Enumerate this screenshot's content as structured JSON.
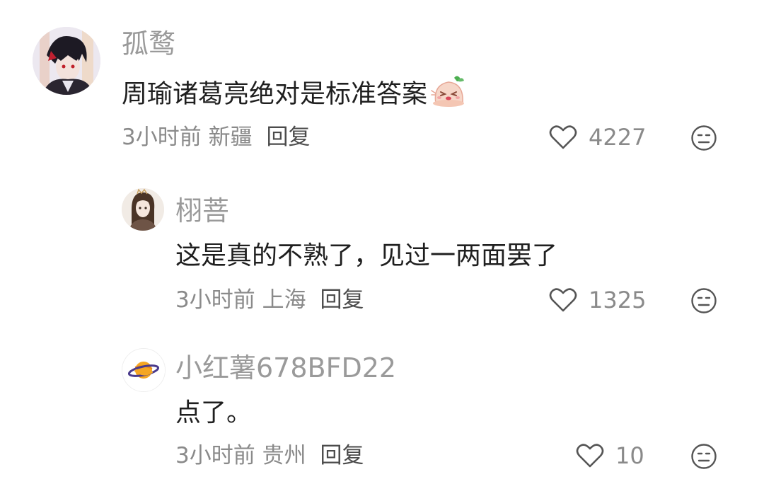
{
  "comments": [
    {
      "username": "孤鹜",
      "text": "周瑜诸葛亮绝对是标准答案",
      "sticker_icon": "pudding-face-sticker",
      "time": "3小时前",
      "location": "新疆",
      "reply_label": "回复",
      "likes": "4227",
      "avatar_icon": "anime-boy-avatar"
    },
    {
      "username": "栩菩",
      "text": "这是真的不熟了，见过一两面罢了",
      "time": "3小时前",
      "location": "上海",
      "reply_label": "回复",
      "likes": "1325",
      "avatar_icon": "anime-girl-avatar"
    },
    {
      "username": "小红薯678BFD22",
      "text": "点了。",
      "time": "3小时前",
      "location": "贵州",
      "reply_label": "回复",
      "likes": "10",
      "avatar_icon": "planet-avatar"
    }
  ],
  "colors": {
    "username": "#9a9a9a",
    "text": "#1f1f1f",
    "meta": "#8a8a8a",
    "reply": "#4b4b4b",
    "icon": "#555555"
  }
}
